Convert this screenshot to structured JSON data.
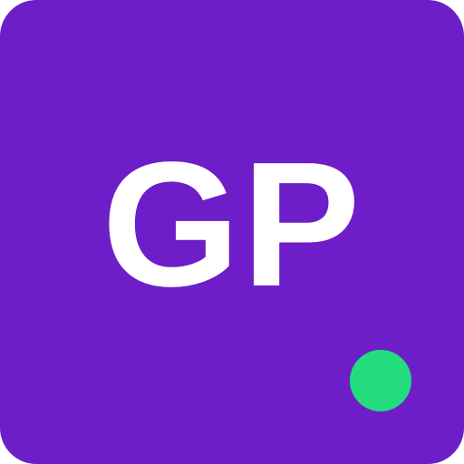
{
  "avatar": {
    "initials": "GP",
    "background_color": "#6d1ec8",
    "text_color": "#ffffff",
    "status_color": "#22dc7e",
    "status_icon": "online-status-dot-icon"
  }
}
